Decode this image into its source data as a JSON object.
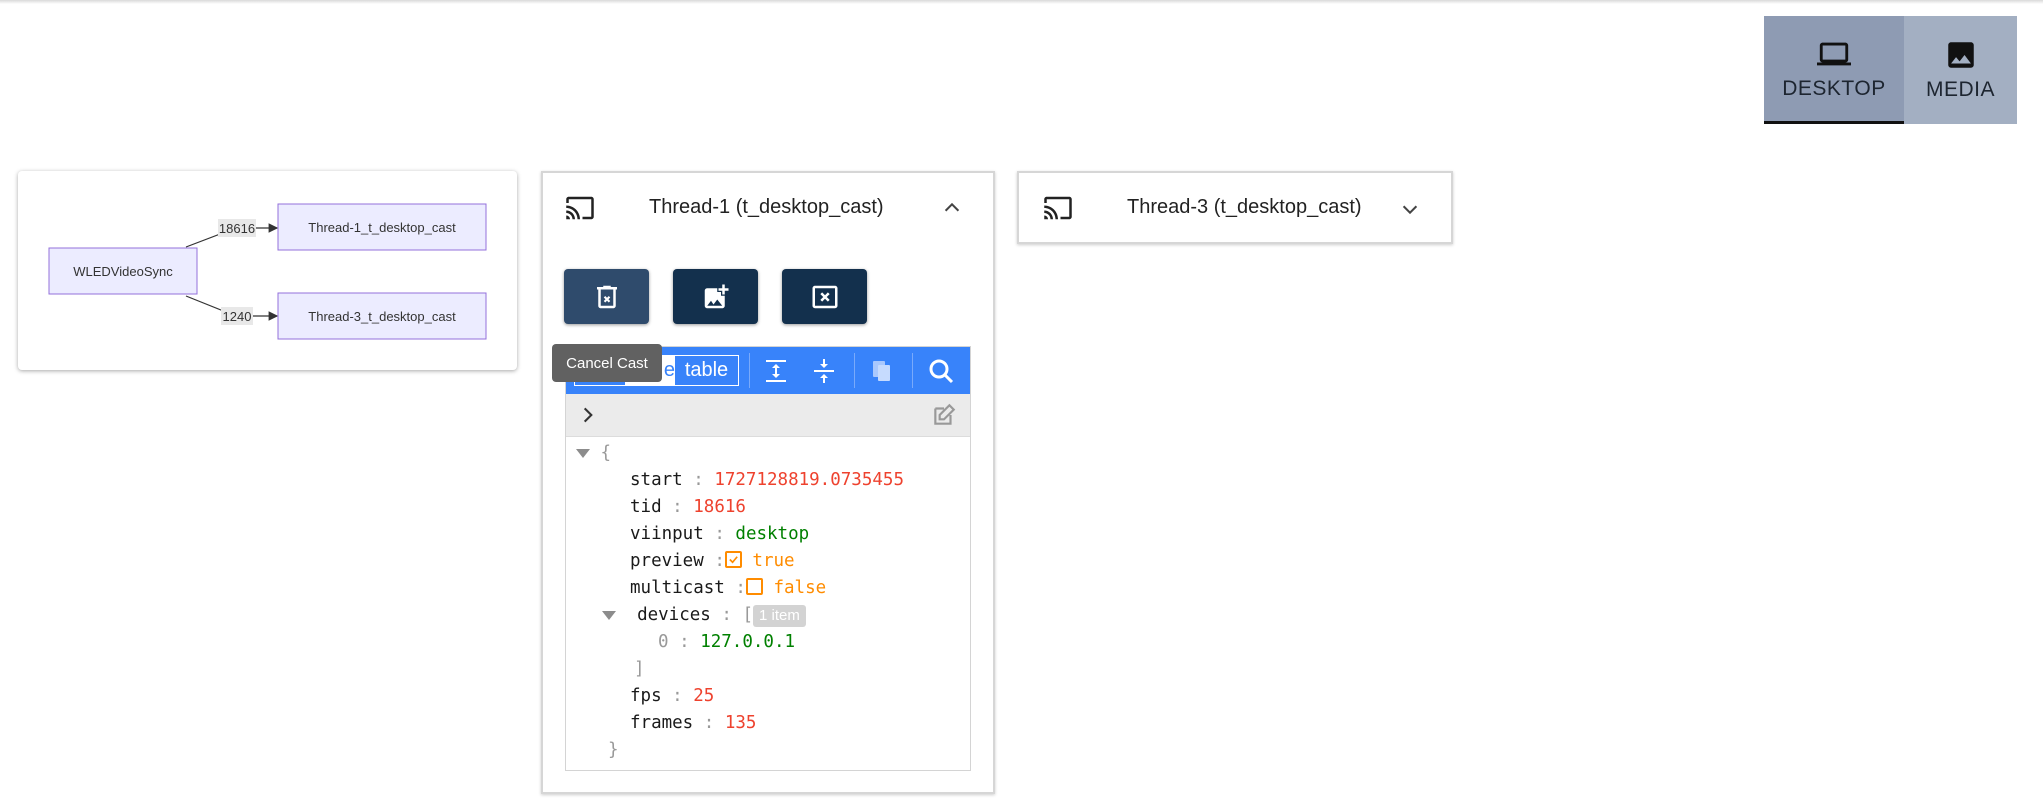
{
  "modes": [
    {
      "label": "DESKTOP",
      "icon": "laptop-icon",
      "active": true
    },
    {
      "label": "MEDIA",
      "icon": "image-icon",
      "active": false
    }
  ],
  "graph": {
    "source": "WLEDVideoSync",
    "edges": [
      {
        "label": "18616",
        "target": "Thread-1_t_desktop_cast"
      },
      {
        "label": "1240",
        "target": "Thread-3_t_desktop_cast"
      }
    ]
  },
  "panels": [
    {
      "title": "Thread-1 (t_desktop_cast)",
      "expanded": true
    },
    {
      "title": "Thread-3 (t_desktop_cast)",
      "expanded": false
    }
  ],
  "actions": [
    {
      "icon": "delete-x-icon"
    },
    {
      "icon": "add-image-icon"
    },
    {
      "icon": "close-box-icon"
    }
  ],
  "tooltip": "Cancel Cast",
  "editor": {
    "mode_partial": "e",
    "mode_label": "table",
    "open_brace": "{",
    "close_brace": "}",
    "fields": {
      "start": {
        "key": "start",
        "value": "1727128819.0735455"
      },
      "tid": {
        "key": "tid",
        "value": "18616"
      },
      "viinput": {
        "key": "viinput",
        "value": "desktop"
      },
      "preview": {
        "key": "preview",
        "value": "true"
      },
      "multicast": {
        "key": "multicast",
        "value": "false"
      },
      "devices": {
        "key": "devices",
        "open": "[",
        "close": "]",
        "count": "1 item",
        "items": [
          {
            "index": "0",
            "value": "127.0.0.1"
          }
        ]
      },
      "fps": {
        "key": "fps",
        "value": "25"
      },
      "frames": {
        "key": "frames",
        "value": "135"
      }
    },
    "separator": ":"
  },
  "colors": {
    "accent": "#3883fa",
    "button": "#13304d",
    "toggle": "#a3afc2",
    "number": "#ee422e",
    "string": "#008000",
    "boolean": "#ff8c00"
  }
}
